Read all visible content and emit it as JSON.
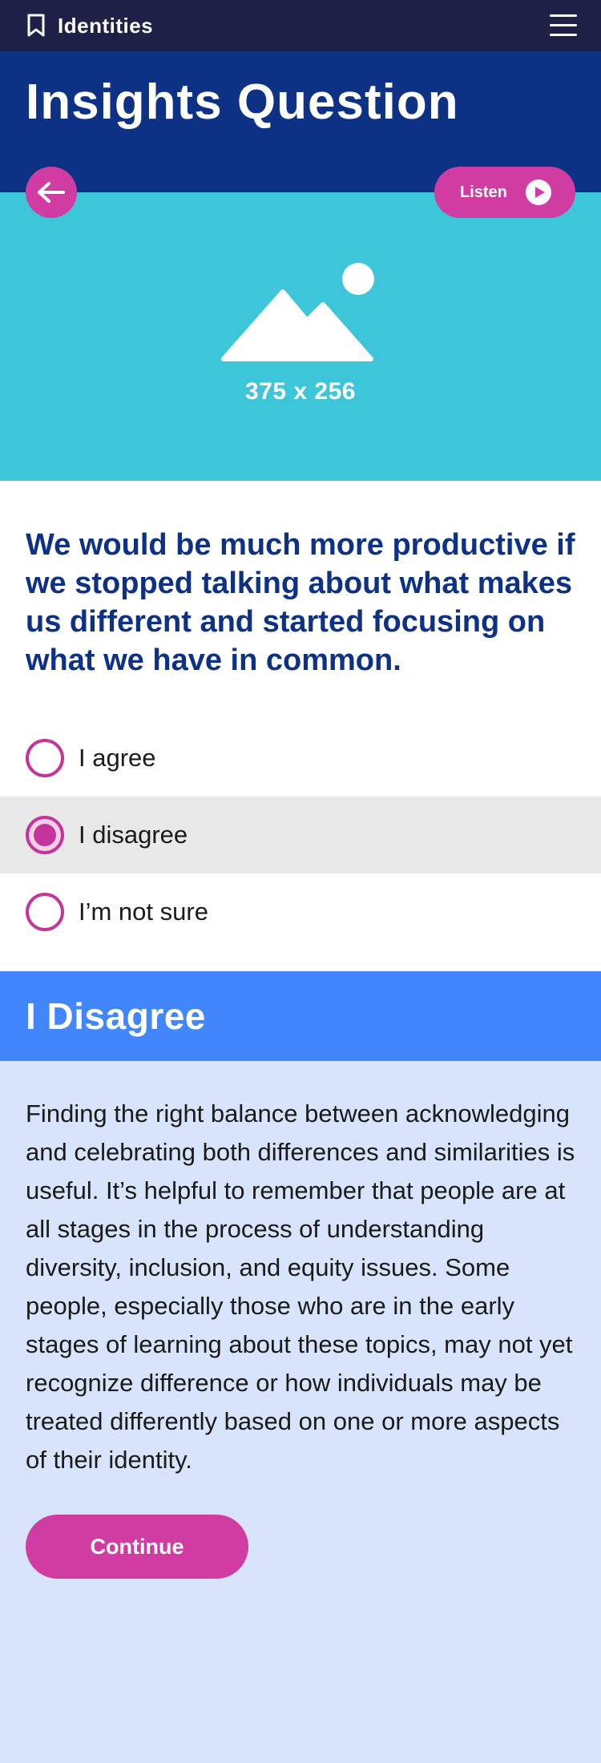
{
  "header": {
    "brand": "Identities",
    "bookmark_icon": "bookmark-icon",
    "menu_icon": "hamburger-menu-icon"
  },
  "page": {
    "title": "Insights Question"
  },
  "hero": {
    "back_icon": "arrow-left-icon",
    "listen_label": "Listen",
    "play_icon": "play-icon",
    "placeholder_icon": "image-placeholder-icon",
    "placeholder_text": "375 x 256"
  },
  "question": {
    "text": "We would be much more productive if we stopped talking about what makes us different and started focusing on what we have in common.",
    "options": [
      {
        "label": "I agree",
        "selected": false
      },
      {
        "label": "I disagree",
        "selected": true
      },
      {
        "label": "I’m not sure",
        "selected": false
      }
    ]
  },
  "feedback": {
    "title": "I Disagree",
    "body": "Finding the right balance between acknowledging and celebrating both differences and similarities is useful. It’s helpful to remember that people are at all stages in the process of understanding diversity, inclusion, and equity issues. Some people, especially those who are in the early stages of learning about these topics, may not yet recognize difference or how individuals may be treated differently based on one or more aspects of their identity.",
    "continue_label": "Continue"
  },
  "colors": {
    "topbar": "#1f2048",
    "title_band": "#0d3185",
    "hero": "#3dc5d9",
    "accent": "#d03ca2",
    "feedback_head": "#4286fb",
    "feedback_body": "#d7e4fb",
    "selected_row": "#e8e8e8"
  }
}
